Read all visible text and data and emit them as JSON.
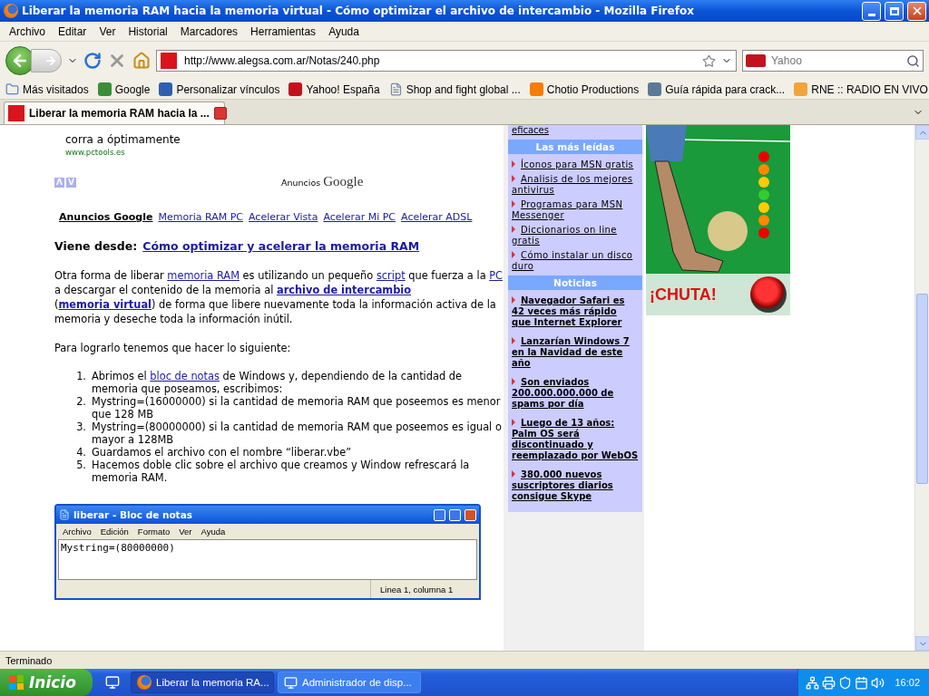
{
  "window": {
    "title": "Liberar la memoria RAM hacia la memoria virtual - Cómo optimizar el archivo de intercambio - Mozilla Firefox"
  },
  "menu": [
    "Archivo",
    "Editar",
    "Ver",
    "Historial",
    "Marcadores",
    "Herramientas",
    "Ayuda"
  ],
  "address": {
    "value": "http://www.alegsa.com.ar/Notas/240.php"
  },
  "search": {
    "placeholder": "Yahoo"
  },
  "bookmarks": [
    {
      "label": "Más visitados",
      "kind": "folder"
    },
    {
      "label": "Google",
      "kind": "google"
    },
    {
      "label": "Personalizar vínculos",
      "kind": "m"
    },
    {
      "label": "Yahoo! España",
      "kind": "yahoo"
    },
    {
      "label": "Shop and fight global ...",
      "kind": "page"
    },
    {
      "label": "Chotio Productions",
      "kind": "blogger"
    },
    {
      "label": "Guía rápida para crack...",
      "kind": "wordpress"
    },
    {
      "label": "RNE :: RADIO EN VIVO",
      "kind": "rtve"
    }
  ],
  "tabs": [
    {
      "label": "Liberar la memoria RAM hacia la ...",
      "selected": true
    }
  ],
  "ad": {
    "text": "corra a óptimamente",
    "url": "www.pctools.es",
    "nav": [
      "Λ",
      "V"
    ],
    "brand_prefix": "Anuncios",
    "brand": "Google"
  },
  "ad_links": {
    "title": "Anuncios Google",
    "links": [
      "Memoria RAM PC",
      "Acelerar Vista",
      "Acelerar Mi PC",
      "Acelerar ADSL"
    ]
  },
  "viene_desde": {
    "label": "Viene desde:",
    "link": "Cómo optimizar y acelerar la memoria RAM"
  },
  "intro": [
    {
      "kind": "text",
      "text": "Otra forma de liberar "
    },
    {
      "kind": "link",
      "text": "memoria RAM"
    },
    {
      "kind": "text",
      "text": " es utilizando un pequeño "
    },
    {
      "kind": "link",
      "text": "script"
    },
    {
      "kind": "text",
      "text": " que fuerza a la "
    },
    {
      "kind": "link",
      "text": "PC"
    },
    {
      "kind": "text",
      "text": " a descargar el contenido de la memoria al "
    },
    {
      "kind": "strong_link",
      "text": "archivo de intercambio"
    },
    {
      "kind": "text",
      "text": " ("
    },
    {
      "kind": "strong_link",
      "text": "memoria virtual"
    },
    {
      "kind": "text",
      "text": ") de forma que libere nuevamente toda la información activa de la memoria y deseche toda la información inútil."
    }
  ],
  "steps_intro": "Para lograrlo tenemos que hacer lo siguiente:",
  "steps": [
    {
      "number": "1.",
      "parts": [
        {
          "kind": "text",
          "text": "Abrimos el "
        },
        {
          "kind": "link",
          "text": "bloc de notas"
        },
        {
          "kind": "text",
          "text": " de Windows y, dependiendo de la cantidad de memoria que poseamos, escribimos:"
        }
      ]
    },
    {
      "number": "2.",
      "parts": [
        {
          "kind": "text",
          "text": "Mystring=(16000000) si la cantidad de memoria RAM que poseemos es menor que 128 MB"
        }
      ]
    },
    {
      "number": "3.",
      "parts": [
        {
          "kind": "text",
          "text": "Mystring=(80000000) si la cantidad de memoria RAM que poseemos es igual o mayor a 128MB"
        }
      ]
    },
    {
      "number": "4.",
      "parts": [
        {
          "kind": "text",
          "text": "Guardamos el archivo con el nombre “liberar.vbe”"
        }
      ]
    },
    {
      "number": "5.",
      "parts": [
        {
          "kind": "text",
          "text": "Hacemos doble clic sobre el archivo que creamos y Window refrescará la memoria RAM."
        }
      ]
    }
  ],
  "notepad": {
    "title": "liberar - Bloc de notas",
    "menu": [
      "Archivo",
      "Edición",
      "Formato",
      "Ver",
      "Ayuda"
    ],
    "content": "Mystring=(80000000)",
    "status": "Linea 1, columna 1"
  },
  "sidebar": {
    "top_link": "eficaces",
    "sections": [
      {
        "title": "Las más leídas",
        "kind": "plain",
        "items": [
          "Íconos para MSN gratis",
          "Analisis de los mejores antivirus",
          "Programas para MSN Messenger",
          "Diccionarios on line gratis",
          "Cómo instalar un disco duro"
        ]
      },
      {
        "title": "Noticias",
        "kind": "bold",
        "items": [
          "Navegador Safari es 42 veces más rápido que Internet Explorer",
          "Lanzarían Windows 7 en la Navidad de este año",
          "Son enviados 200.000.000.000 de spams por día",
          "Luego de 13 años: Palm OS será discontinuado y reemplazado por WebOS",
          "380.000 nuevos suscriptores diarios consigue Skype"
        ]
      }
    ]
  },
  "banner": {
    "text": "¡CHUTA!"
  },
  "status_bar": "Terminado",
  "taskbar": {
    "start": "Inicio",
    "tasks": [
      {
        "label": "Liberar la memoria RA...",
        "kind": "firefox",
        "selected": true
      },
      {
        "label": "Administrador de disp...",
        "kind": "computer",
        "selected": false
      }
    ],
    "clock": "16:02"
  }
}
